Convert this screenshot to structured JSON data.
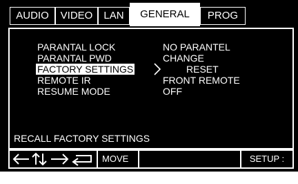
{
  "tabs": [
    {
      "label": "AUDIO",
      "active": false
    },
    {
      "label": "VIDEO",
      "active": false
    },
    {
      "label": "LAN",
      "active": false
    },
    {
      "label": "GENERAL",
      "active": true
    },
    {
      "label": "PROG",
      "active": false
    }
  ],
  "settings": [
    {
      "label": "PARANTAL LOCK",
      "value": "NO PARANTEL"
    },
    {
      "label": "PARANTAL PWD",
      "value": "CHANGE"
    },
    {
      "label": "FACTORY SETTINGS",
      "value": "RESET",
      "selected": true
    },
    {
      "label": "REMOTE IR",
      "value": "FRONT REMOTE"
    },
    {
      "label": "RESUME MODE",
      "value": "OFF"
    }
  ],
  "hint_text": "RECALL FACTORY SETTINGS",
  "bottom_bar": {
    "move_label": "MOVE",
    "exit_label": "SETUP : Exit",
    "arrow_icons": [
      "left-arrow-icon",
      "up-down-arrow-icon",
      "right-arrow-icon",
      "enter-arrow-icon"
    ]
  },
  "colors": {
    "background": "#000000",
    "foreground": "#ffffff",
    "highlight": "#ffffff",
    "highlight_text": "#000000"
  }
}
